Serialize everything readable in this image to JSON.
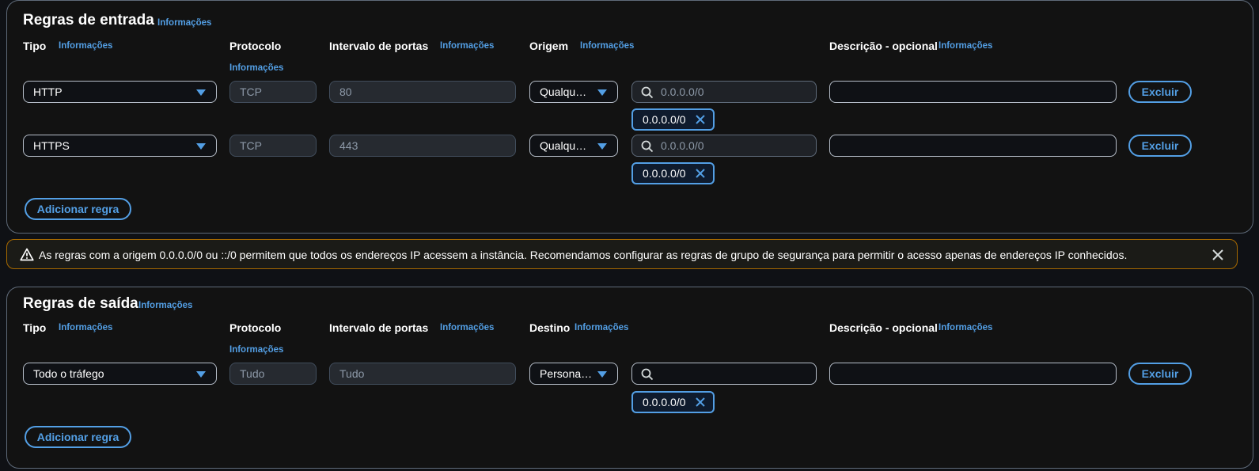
{
  "inbound": {
    "title": "Regras de entrada",
    "title_info": "Informações",
    "headers": {
      "tipo": "Tipo",
      "tipo_info": "Informações",
      "protocolo": "Protocolo",
      "protocolo_info": "Informações",
      "intervalo": "Intervalo de portas",
      "intervalo_info": "Informações",
      "origem": "Origem",
      "origem_info": "Informações",
      "descricao": "Descrição - opcional",
      "descricao_info": "Informações"
    },
    "rows": [
      {
        "tipo": "HTTP",
        "protocolo": "TCP",
        "portas": "80",
        "origem": "Qualqu…",
        "search_value": "0.0.0.0/0",
        "token": "0.0.0.0/0",
        "descricao": "",
        "excluir": "Excluir"
      },
      {
        "tipo": "HTTPS",
        "protocolo": "TCP",
        "portas": "443",
        "origem": "Qualqu…",
        "search_value": "0.0.0.0/0",
        "token": "0.0.0.0/0",
        "descricao": "",
        "excluir": "Excluir"
      }
    ],
    "add_rule": "Adicionar regra"
  },
  "alert": {
    "text": "As regras com a origem 0.0.0.0/0 ou ::/0 permitem que todos os endereços IP acessem a instância. Recomendamos configurar as regras de grupo de segurança para permitir o acesso apenas de endereços IP conhecidos.",
    "icon": "warning-icon",
    "color": "#a86a00"
  },
  "outbound": {
    "title": "Regras de saída",
    "title_info": "Informações",
    "headers": {
      "tipo": "Tipo",
      "tipo_info": "Informações",
      "protocolo": "Protocolo",
      "protocolo_info": "Informações",
      "intervalo": "Intervalo de portas",
      "intervalo_info": "Informações",
      "destino": "Destino",
      "destino_info": "Informações",
      "descricao": "Descrição - opcional",
      "descricao_info": "Informações"
    },
    "rows": [
      {
        "tipo": "Todo o tráfego",
        "protocolo": "Tudo",
        "portas": "Tudo",
        "destino": "Persona…",
        "search_value": "",
        "token": "0.0.0.0/0",
        "descricao": "",
        "excluir": "Excluir"
      }
    ],
    "add_rule": "Adicionar regra"
  },
  "colors": {
    "accent": "#539fe5",
    "background": "#0f1115",
    "warning": "#a86a00"
  }
}
